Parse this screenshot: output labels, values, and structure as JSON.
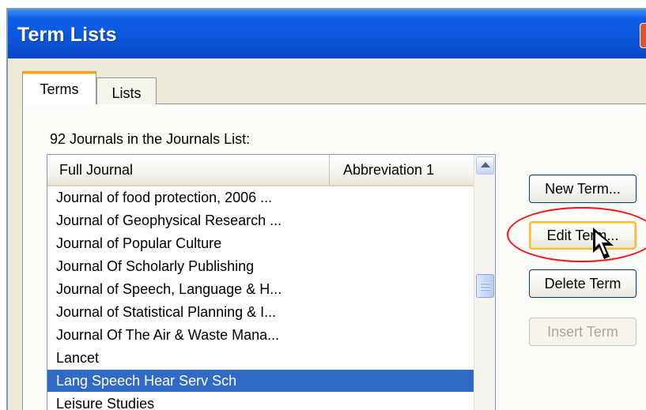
{
  "window": {
    "title": "Term Lists"
  },
  "tabs": [
    {
      "label": "Terms",
      "selected": true
    },
    {
      "label": "Lists",
      "selected": false
    }
  ],
  "panel": {
    "count_label": "92 Journals in the Journals List:"
  },
  "journal_list": {
    "columns": [
      {
        "label": "Full Journal"
      },
      {
        "label": "Abbreviation 1"
      }
    ],
    "rows": [
      {
        "full_journal": "Journal of food protection, 2006 ..."
      },
      {
        "full_journal": "Journal of Geophysical Research ..."
      },
      {
        "full_journal": "Journal of Popular Culture"
      },
      {
        "full_journal": "Journal Of Scholarly Publishing"
      },
      {
        "full_journal": "Journal of Speech, Language & H..."
      },
      {
        "full_journal": "Journal of Statistical Planning & I..."
      },
      {
        "full_journal": "Journal Of The Air & Waste Mana..."
      },
      {
        "full_journal": "Lancet"
      },
      {
        "full_journal": "Lang Speech Hear Serv Sch",
        "selected": true
      },
      {
        "full_journal": "Leisure Studies"
      }
    ]
  },
  "buttons": {
    "new_term": "New Term...",
    "edit_term": "Edit Term...",
    "delete_term": "Delete Term",
    "insert_term": "Insert Term"
  },
  "icons": {
    "close": "close-icon",
    "scroll_up": "chevron-up-icon",
    "pointer": "mouse-pointer-icon"
  },
  "colors": {
    "title_bar": "#0b55da",
    "selection": "#316ac5",
    "active_tab": "#ff9f1a",
    "highlight_circle": "#ff1010",
    "disabled_text": "#aca899"
  }
}
